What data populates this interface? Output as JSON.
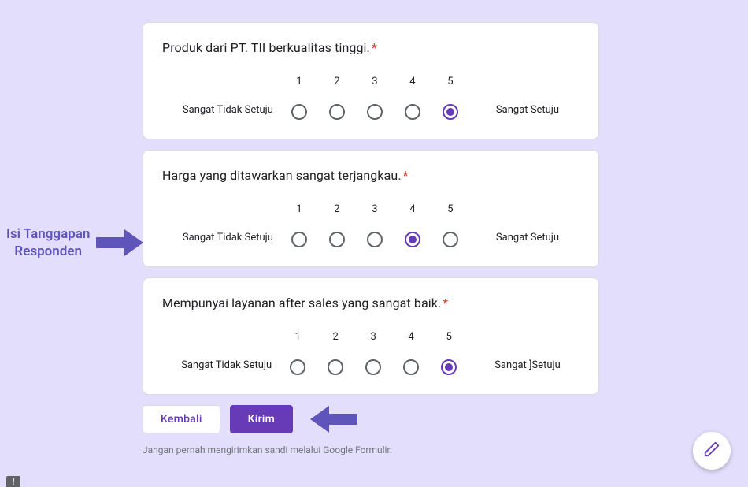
{
  "annotation": {
    "line1": "Isi Tanggapan",
    "line2": "Responden"
  },
  "scale_numbers": [
    "1",
    "2",
    "3",
    "4",
    "5"
  ],
  "questions": [
    {
      "title": "Produk dari PT. TII berkualitas tinggi.",
      "left": "Sangat Tidak Setuju",
      "right": "Sangat Setuju",
      "selected": 5
    },
    {
      "title": "Harga yang ditawarkan sangat terjangkau.",
      "left": "Sangat Tidak Setuju",
      "right": "Sangat Setuju",
      "selected": 4
    },
    {
      "title": "Mempunyai layanan after sales yang sangat baik.",
      "left": "Sangat Tidak Setuju",
      "right": "Sangat ]Setuju",
      "selected": 5
    }
  ],
  "buttons": {
    "back": "Kembali",
    "submit": "Kirim"
  },
  "footer": "Jangan pernah mengirimkan sandi melalui Google Formulir.",
  "report_char": "!"
}
